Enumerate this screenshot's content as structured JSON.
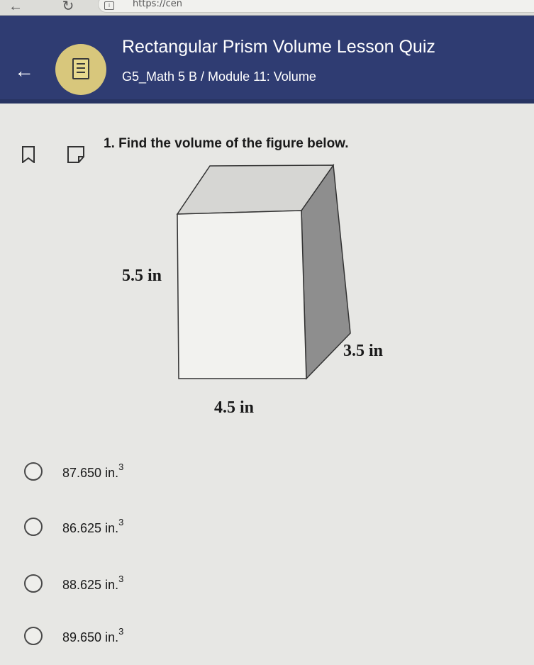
{
  "browser": {
    "back_icon": "←",
    "reload_icon": "↻",
    "url": "https://cen"
  },
  "header": {
    "back_icon": "←",
    "title": "Rectangular Prism Volume Lesson Quiz",
    "subtitle": "G5_Math 5 B / Module 11: Volume"
  },
  "question": {
    "text": "1. Find the volume of the figure below.",
    "figure": {
      "height_label": "5.5 in",
      "depth_label": "3.5 in",
      "width_label": "4.5 in"
    }
  },
  "options": [
    {
      "value": "87.650",
      "unit": "in.",
      "exponent": "3"
    },
    {
      "value": "86.625",
      "unit": "in.",
      "exponent": "3"
    },
    {
      "value": "88.625",
      "unit": "in.",
      "exponent": "3"
    },
    {
      "value": "89.650",
      "unit": "in.",
      "exponent": "3"
    }
  ],
  "colors": {
    "header_bg": "#2f3c72",
    "logo_bg": "#d8c77c",
    "page_bg": "#e7e7e4"
  }
}
